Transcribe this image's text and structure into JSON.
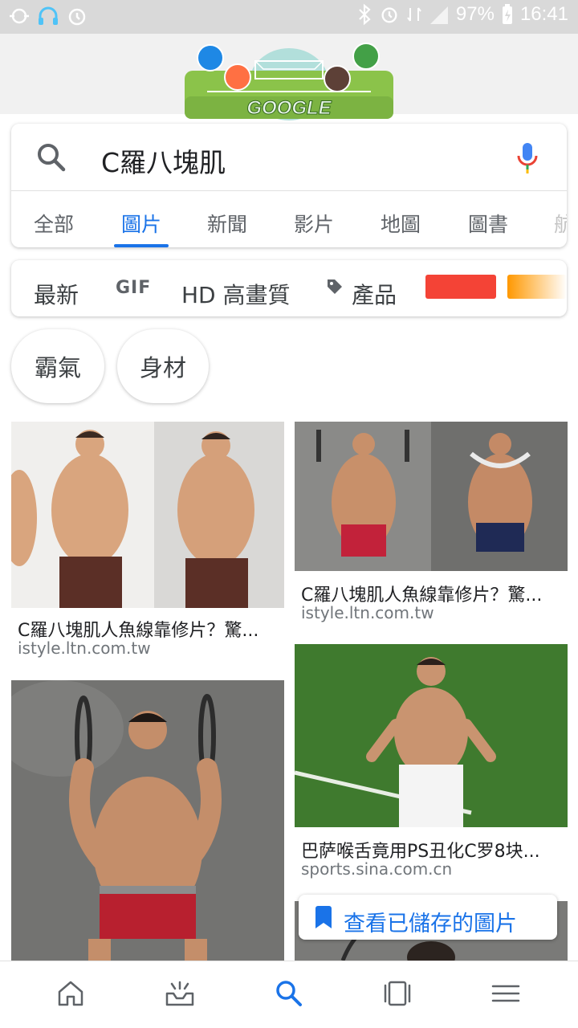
{
  "status_bar": {
    "battery_percent": "97%",
    "time": "16:41",
    "icons": [
      "app-icon",
      "headphones-icon",
      "alarm-icon",
      "bluetooth-icon",
      "alarm-icon",
      "data-icon",
      "signal-icon",
      "battery-charging-icon"
    ]
  },
  "header": {
    "doodle_text": "GOOGLE"
  },
  "search": {
    "query": "C羅八塊肌"
  },
  "tabs": [
    {
      "label": "全部"
    },
    {
      "label": "圖片"
    },
    {
      "label": "新聞"
    },
    {
      "label": "影片"
    },
    {
      "label": "地圖"
    },
    {
      "label": "圖書"
    },
    {
      "label": "航"
    }
  ],
  "filters": {
    "newest": "最新",
    "gif": "GIF",
    "hd": "HD 高畫質",
    "product": "產品",
    "color_swatches": [
      "#f44336",
      "#ff9800"
    ]
  },
  "suggestions": [
    {
      "label": "霸氣"
    },
    {
      "label": "身材"
    }
  ],
  "results": [
    {
      "caption": "C羅八塊肌人魚線靠修片？驚...",
      "source": "istyle.ltn.com.tw"
    },
    {
      "caption": "C羅八塊肌人魚線靠修片？驚...",
      "source": "istyle.ltn.com.tw"
    },
    {
      "caption": "巴萨喉舌竟用PS丑化C罗8块...",
      "source": "sports.sina.com.cn"
    },
    {
      "caption": "",
      "source": ""
    }
  ],
  "saved_button": {
    "label": "查看已儲存的圖片"
  },
  "accent_color": "#1a73e8"
}
